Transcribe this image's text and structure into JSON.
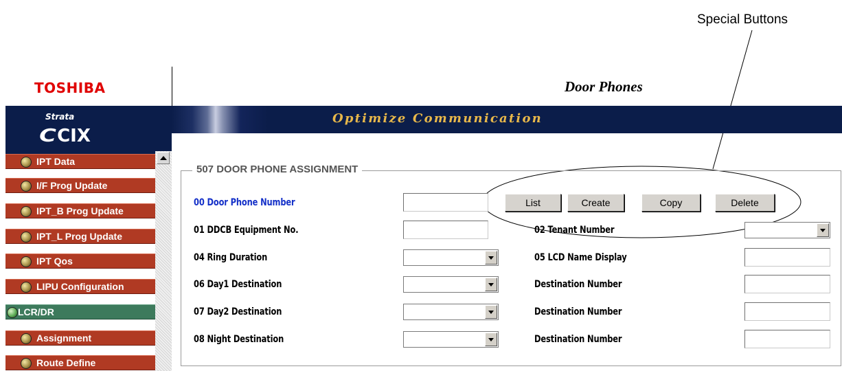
{
  "callout": {
    "label": "Special Buttons"
  },
  "header": {
    "brand": "TOSHIBA",
    "page_title": "Door Phones",
    "slogan": "Optimize Communication"
  },
  "sidebar": {
    "logo_top": "Strata",
    "logo_main": "CIX",
    "items": [
      {
        "label": "IPT Data",
        "active": false
      },
      {
        "label": "I/F Prog Update",
        "active": false
      },
      {
        "label": "IPT_B Prog Update",
        "active": false
      },
      {
        "label": "IPT_L Prog Update",
        "active": false
      },
      {
        "label": "IPT Qos",
        "active": false
      },
      {
        "label": "LIPU Configuration",
        "active": false
      },
      {
        "label": "LCR/DR",
        "active": true
      },
      {
        "label": "Assignment",
        "active": false
      },
      {
        "label": "Route Define",
        "active": false
      }
    ]
  },
  "form": {
    "legend": "507 DOOR PHONE ASSIGNMENT",
    "buttons": {
      "list": "List",
      "create": "Create",
      "copy": "Copy",
      "delete": "Delete"
    },
    "fields": {
      "door_phone_number": {
        "label": "00 Door Phone Number",
        "value": ""
      },
      "ddcb_equipment_no": {
        "label": "01 DDCB Equipment No.",
        "value": ""
      },
      "tenant_number": {
        "label": "02 Tenant Number",
        "value": ""
      },
      "ring_duration": {
        "label": "04 Ring Duration",
        "value": ""
      },
      "lcd_name_display": {
        "label": "05 LCD Name Display",
        "value": ""
      },
      "day1_destination": {
        "label": "06 Day1 Destination",
        "value": ""
      },
      "day1_destination_number": {
        "label": "Destination Number",
        "value": ""
      },
      "day2_destination": {
        "label": "07 Day2 Destination",
        "value": ""
      },
      "day2_destination_number": {
        "label": "Destination Number",
        "value": ""
      },
      "night_destination": {
        "label": "08 Night Destination",
        "value": ""
      },
      "night_destination_number": {
        "label": "Destination Number",
        "value": ""
      }
    }
  }
}
